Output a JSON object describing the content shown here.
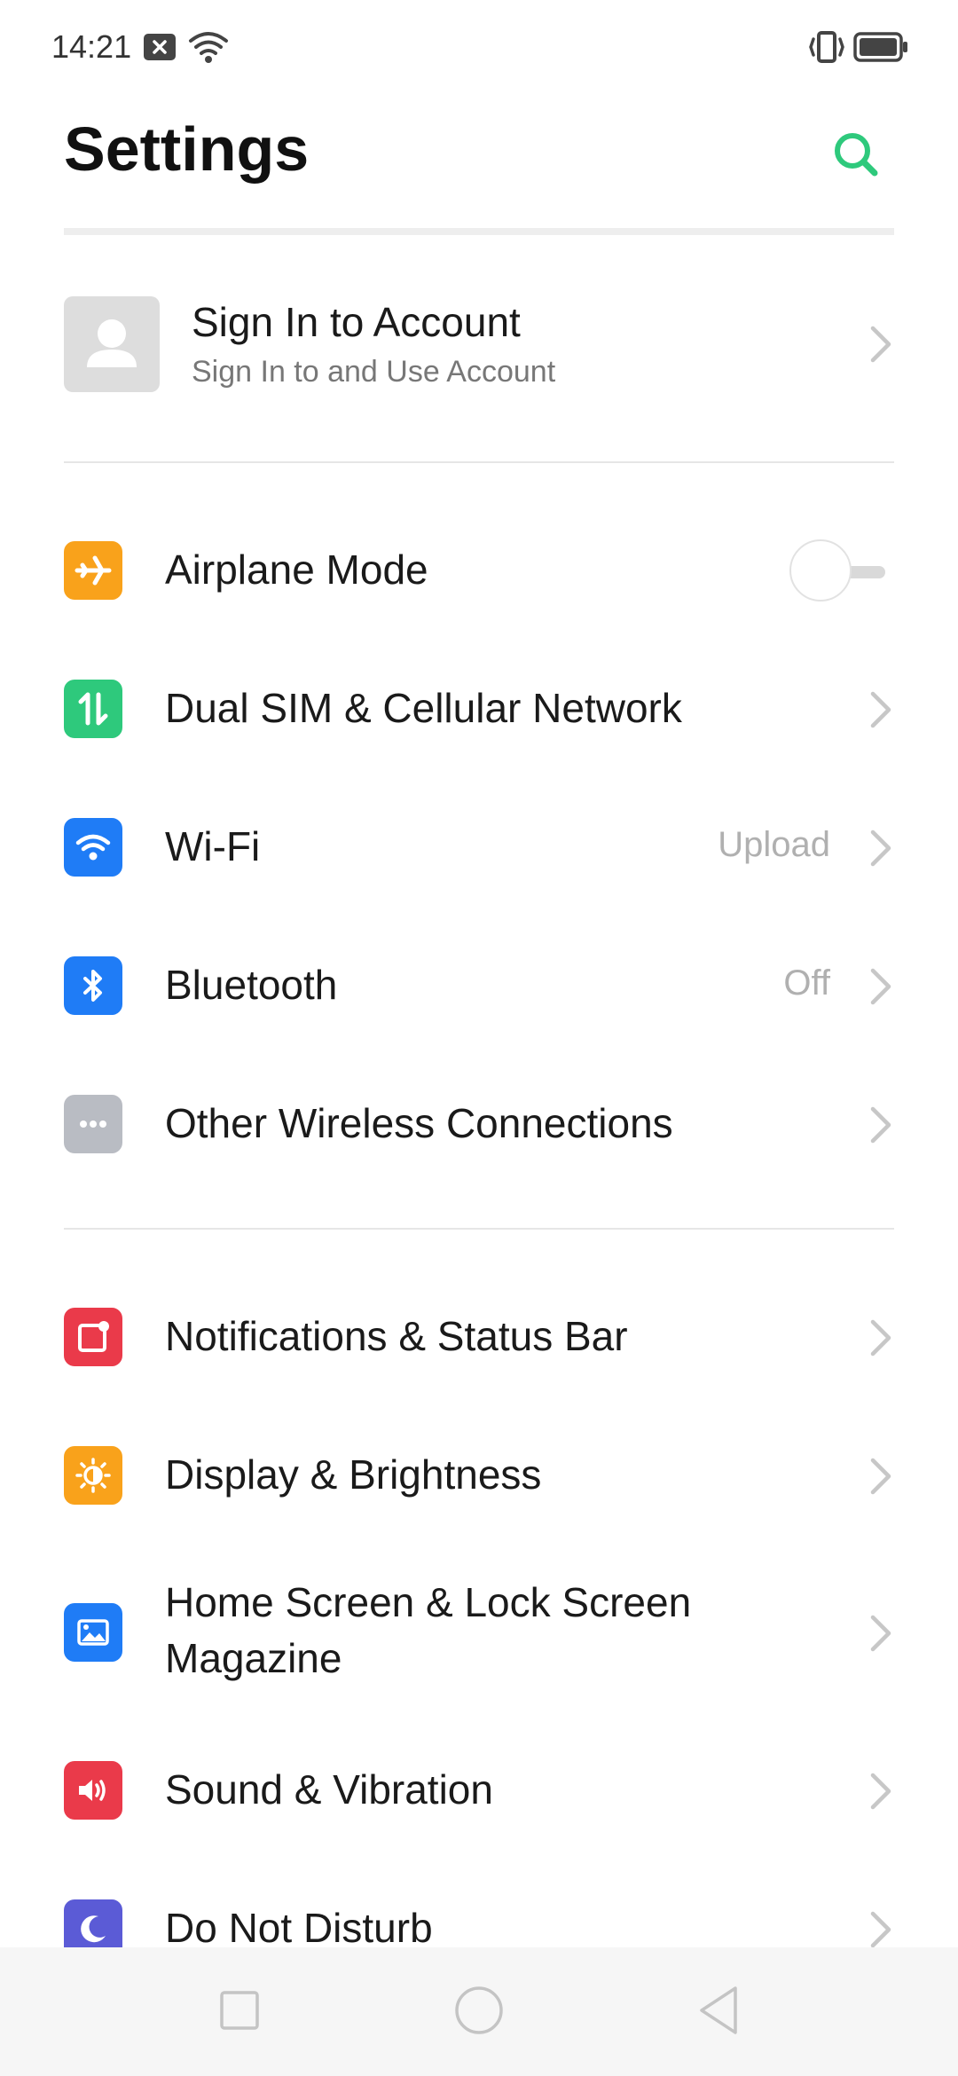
{
  "status_bar": {
    "time": "14:21"
  },
  "header": {
    "title": "Settings"
  },
  "account": {
    "title": "Sign In to Account",
    "subtitle": "Sign In to and Use Account"
  },
  "items": [
    {
      "label": "Airplane Mode",
      "icon": "airplane-icon",
      "color": "#f9a21b",
      "toggle": false
    },
    {
      "label": "Dual SIM & Cellular Network",
      "icon": "cellular-arrows-icon",
      "color": "#2ec97c"
    },
    {
      "label": "Wi-Fi",
      "icon": "wifi-icon",
      "color": "#1f7cf6",
      "value": "Upload"
    },
    {
      "label": "Bluetooth",
      "icon": "bluetooth-icon",
      "color": "#1f7cf6",
      "value": "Off"
    },
    {
      "label": "Other Wireless Connections",
      "icon": "more-dots-icon",
      "color": "#b9bcc3"
    },
    {
      "label": "Notifications & Status Bar",
      "icon": "notification-icon",
      "color": "#ea3a4a"
    },
    {
      "label": "Display & Brightness",
      "icon": "brightness-icon",
      "color": "#f9a21b"
    },
    {
      "label": "Home Screen & Lock Screen",
      "label_line2": "Magazine",
      "icon": "wallpaper-icon",
      "color": "#1f7cf6"
    },
    {
      "label": "Sound & Vibration",
      "icon": "speaker-icon",
      "color": "#ea3a4a"
    },
    {
      "label": "Do Not Disturb",
      "icon": "moon-icon",
      "color": "#5b5bd6"
    }
  ],
  "colors": {
    "accent": "#2ec97c",
    "chevron": "#c7c7c7",
    "secondary_text": "#b0b0b0"
  }
}
